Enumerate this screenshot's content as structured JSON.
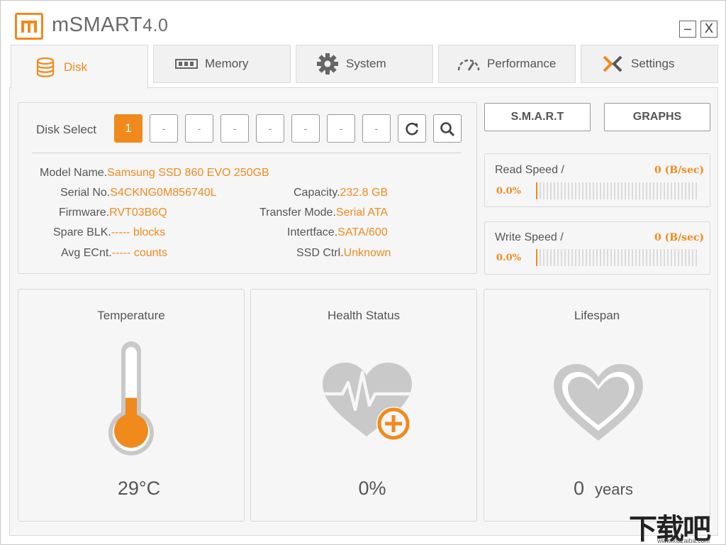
{
  "app": {
    "name": "mSMART",
    "version": "4.0",
    "minimize_label": "–",
    "close_label": "X"
  },
  "tabs": [
    {
      "label": "Disk",
      "icon": "database-icon",
      "active": true
    },
    {
      "label": "Memory",
      "icon": "memory-chip-icon",
      "active": false
    },
    {
      "label": "System",
      "icon": "gear-icon",
      "active": false
    },
    {
      "label": "Performance",
      "icon": "speedometer-icon",
      "active": false
    },
    {
      "label": "Settings",
      "icon": "settings-x-icon",
      "active": false
    }
  ],
  "disk_select": {
    "label": "Disk Select",
    "buttons": [
      "1",
      "-",
      "-",
      "-",
      "-",
      "-",
      "-",
      "-"
    ],
    "selected": "1",
    "refresh_icon": "refresh-icon",
    "search_icon": "search-icon"
  },
  "disk_info": {
    "model_name": {
      "label": "Model Name.",
      "value": "Samsung SSD 860 EVO 250GB"
    },
    "serial_no": {
      "label": "Serial No.",
      "value": "S4CKNG0M856740L"
    },
    "capacity": {
      "label": "Capacity.",
      "value": "232.8 GB"
    },
    "firmware": {
      "label": "Firmware.",
      "value": "RVT03B6Q"
    },
    "transfer_mode": {
      "label": "Transfer Mode.",
      "value": "Serial ATA"
    },
    "spare_blk": {
      "label": "Spare BLK.",
      "value": "----- blocks"
    },
    "interface": {
      "label": "Intertface.",
      "value": "SATA/600"
    },
    "avg_ecnt": {
      "label": "Avg ECnt.",
      "value": "----- counts"
    },
    "ssd_ctrl": {
      "label": "SSD Ctrl.",
      "value": "Unknown"
    }
  },
  "actions": {
    "smart_label": "S.M.A.R.T",
    "graphs_label": "GRAPHS"
  },
  "read_speed": {
    "title": "Read Speed /",
    "value": "0 (B/sec)",
    "percent": "0.0%",
    "fraction": 0.0
  },
  "write_speed": {
    "title": "Write Speed /",
    "value": "0 (B/sec)",
    "percent": "0.0%",
    "fraction": 0.0
  },
  "cards": {
    "temperature": {
      "title": "Temperature",
      "value": "29°C",
      "fill_fraction": 0.4
    },
    "health": {
      "title": "Health Status",
      "value": "0%"
    },
    "lifespan": {
      "title": "Lifespan",
      "value": "0",
      "unit": "years"
    }
  },
  "colors": {
    "accent": "#f08a1c",
    "icon_gray": "#c9c9c9",
    "text": "#555555"
  },
  "watermark": {
    "text": "下载吧",
    "sub": "www.xiazaiba.com"
  }
}
